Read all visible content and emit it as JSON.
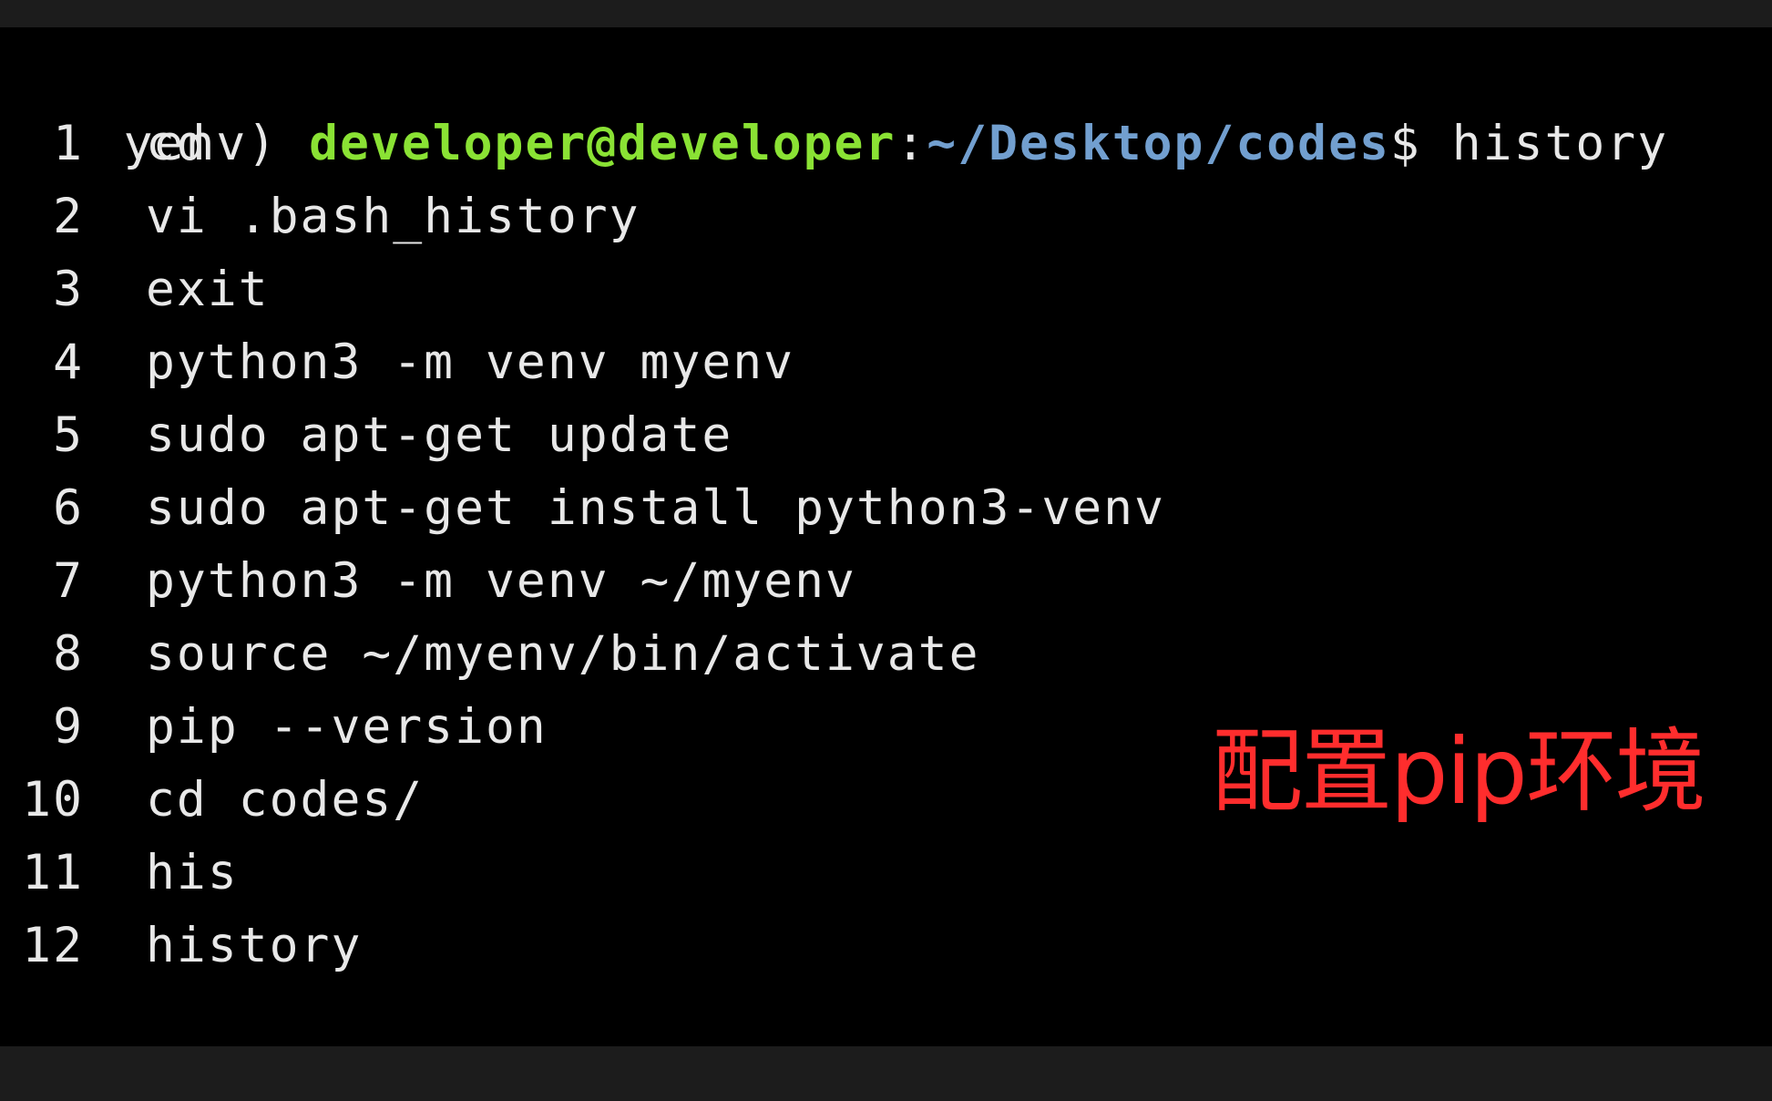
{
  "prompt": {
    "env": "yenv) ",
    "user_host": "developer@developer",
    "colon": ":",
    "path": "~/Desktop/codes",
    "dollar": "$",
    "command": " history"
  },
  "history": [
    {
      "num": "1",
      "cmd": "cd"
    },
    {
      "num": "2",
      "cmd": "vi .bash_history"
    },
    {
      "num": "3",
      "cmd": "exit"
    },
    {
      "num": "4",
      "cmd": "python3 -m venv myenv"
    },
    {
      "num": "5",
      "cmd": "sudo apt-get update"
    },
    {
      "num": "6",
      "cmd": "sudo apt-get install python3-venv"
    },
    {
      "num": "7",
      "cmd": "python3 -m venv ~/myenv"
    },
    {
      "num": "8",
      "cmd": "source ~/myenv/bin/activate"
    },
    {
      "num": "9",
      "cmd": "pip --version"
    },
    {
      "num": "10",
      "cmd": "cd codes/"
    },
    {
      "num": "11",
      "cmd": "his"
    },
    {
      "num": "12",
      "cmd": "history"
    }
  ],
  "overlay_caption": "配置pip环境",
  "colors": {
    "user": "#8ae234",
    "path": "#729fcf",
    "text": "#e8e8e8",
    "overlay": "#ff2d2d",
    "background": "#000000"
  }
}
